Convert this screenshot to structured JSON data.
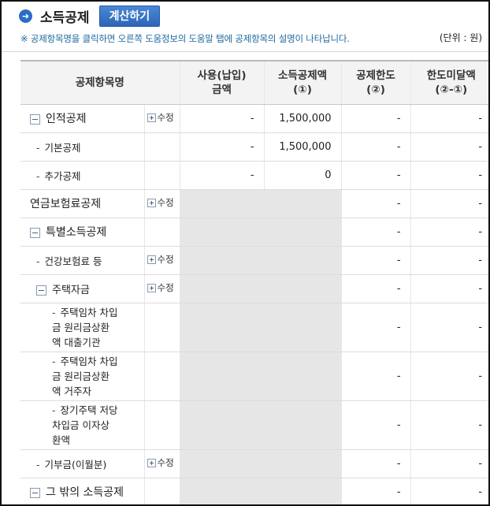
{
  "header": {
    "title": "소득공제",
    "calc_button": "계산하기",
    "notice": "※ 공제항목명을 클릭하면 오른쪽 도움정보의 도움말 탭에 공제항목의 설명이 나타납니다.",
    "unit": "(단위 : 원)"
  },
  "table": {
    "columns": {
      "name": "공제항목명",
      "used_line1": "사용(납입)",
      "used_line2": "금액",
      "deduct_line1": "소득공제액",
      "deduct_line2": "(①)",
      "limit_line1": "공제한도",
      "limit_line2": "(②)",
      "remain_line1": "한도미달액",
      "remain_line2": "(②-①)"
    },
    "edit_label": "수정",
    "rows": [
      {
        "name": "인적공제",
        "used": "-",
        "deduct": "1,500,000",
        "limit": "-",
        "remain": "-"
      },
      {
        "name": "기본공제",
        "used": "-",
        "deduct": "1,500,000",
        "limit": "-",
        "remain": "-"
      },
      {
        "name": "추가공제",
        "used": "-",
        "deduct": "0",
        "limit": "-",
        "remain": "-"
      },
      {
        "name": "연금보험료공제",
        "limit": "-",
        "remain": "-"
      },
      {
        "name": "특별소득공제",
        "limit": "-",
        "remain": "-"
      },
      {
        "name": "건강보험료 등",
        "limit": "-",
        "remain": "-"
      },
      {
        "name": "주택자금",
        "limit": "-",
        "remain": "-"
      },
      {
        "name_l1": "주택임차 차입",
        "name_l2": "금 원리금상환",
        "name_l3": "액 대출기관",
        "limit": "-",
        "remain": "-"
      },
      {
        "name_l1": "주택임차 차입",
        "name_l2": "금 원리금상환",
        "name_l3": "액 거주자",
        "limit": "-",
        "remain": "-"
      },
      {
        "name_l1": "장기주택 저당",
        "name_l2": "차입금 이자상",
        "name_l3": "환액",
        "limit": "-",
        "remain": "-"
      },
      {
        "name": "기부금(이월분)",
        "limit": "-",
        "remain": "-"
      },
      {
        "name": "그 밖의 소득공제",
        "limit": "-",
        "remain": "-"
      }
    ]
  }
}
